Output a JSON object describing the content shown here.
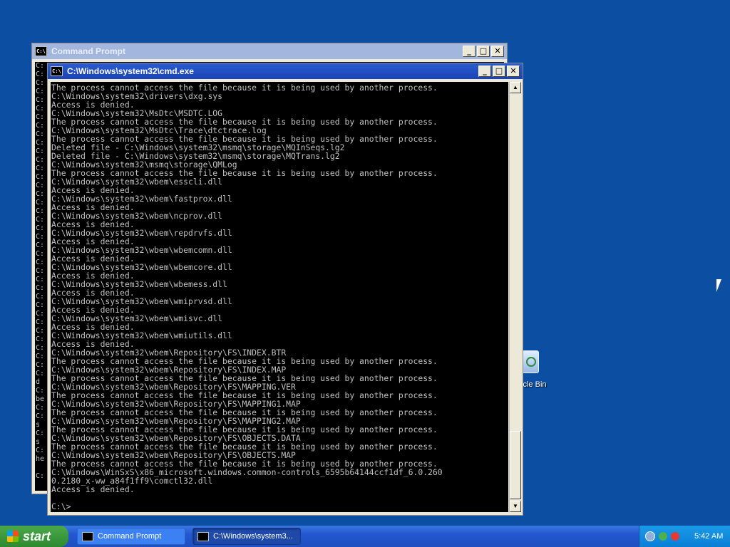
{
  "desktop": {
    "recycle_bin_label": "cle Bin"
  },
  "background_window": {
    "title": "Command Prompt",
    "left_chars": "C:\nC:\nC:\nC:\nC:\nC:\nC:\nC:\nC:\nC:\nC:\nC:\nC:\nC:\nC:\nC:\nC:\nC:\nC:\nC:\nC:\nC:\nC:\nC:\nC:\nC:\nC:\nC:\nC:\nC:\nC:\nC:\nC:\nC:\nC:\nC:\nC:\nd\nC:\nbe\nC:\nC:\ns\nC:\ns\nC:\nhe\n\nC:"
  },
  "cmd_window": {
    "title": "C:\\Windows\\system32\\cmd.exe",
    "output": "The process cannot access the file because it is being used by another process.\nC:\\Windows\\system32\\drivers\\dxg.sys\nAccess is denied.\nC:\\Windows\\system32\\MsDtc\\MSDTC.LOG\nThe process cannot access the file because it is being used by another process.\nC:\\Windows\\system32\\MsDtc\\Trace\\dtctrace.log\nThe process cannot access the file because it is being used by another process.\nDeleted file - C:\\Windows\\system32\\msmq\\storage\\MQInSeqs.lg2\nDeleted file - C:\\Windows\\system32\\msmq\\storage\\MQTrans.lg2\nC:\\Windows\\system32\\msmq\\storage\\QMLog\nThe process cannot access the file because it is being used by another process.\nC:\\Windows\\system32\\wbem\\esscli.dll\nAccess is denied.\nC:\\Windows\\system32\\wbem\\fastprox.dll\nAccess is denied.\nC:\\Windows\\system32\\wbem\\ncprov.dll\nAccess is denied.\nC:\\Windows\\system32\\wbem\\repdrvfs.dll\nAccess is denied.\nC:\\Windows\\system32\\wbem\\wbemcomn.dll\nAccess is denied.\nC:\\Windows\\system32\\wbem\\wbemcore.dll\nAccess is denied.\nC:\\Windows\\system32\\wbem\\wbemess.dll\nAccess is denied.\nC:\\Windows\\system32\\wbem\\wmiprvsd.dll\nAccess is denied.\nC:\\Windows\\system32\\wbem\\wmisvc.dll\nAccess is denied.\nC:\\Windows\\system32\\wbem\\wmiutils.dll\nAccess is denied.\nC:\\Windows\\system32\\wbem\\Repository\\FS\\INDEX.BTR\nThe process cannot access the file because it is being used by another process.\nC:\\Windows\\system32\\wbem\\Repository\\FS\\INDEX.MAP\nThe process cannot access the file because it is being used by another process.\nC:\\Windows\\system32\\wbem\\Repository\\FS\\MAPPING.VER\nThe process cannot access the file because it is being used by another process.\nC:\\Windows\\system32\\wbem\\Repository\\FS\\MAPPING1.MAP\nThe process cannot access the file because it is being used by another process.\nC:\\Windows\\system32\\wbem\\Repository\\FS\\MAPPING2.MAP\nThe process cannot access the file because it is being used by another process.\nC:\\Windows\\system32\\wbem\\Repository\\FS\\OBJECTS.DATA\nThe process cannot access the file because it is being used by another process.\nC:\\Windows\\system32\\wbem\\Repository\\FS\\OBJECTS.MAP\nThe process cannot access the file because it is being used by another process.\nC:\\Windows\\WinSxS\\x86_microsoft.windows.common-controls_6595b64144ccf1df_6.0.260\n0.2180_x-ww_a84f1ff9\\comctl32.dll\nAccess is denied.\n\nC:\\>"
  },
  "taskbar": {
    "start_label": "start",
    "tasks": [
      {
        "label": "Command Prompt"
      },
      {
        "label": "C:\\Windows\\system3..."
      }
    ],
    "clock": "5:42 AM"
  }
}
